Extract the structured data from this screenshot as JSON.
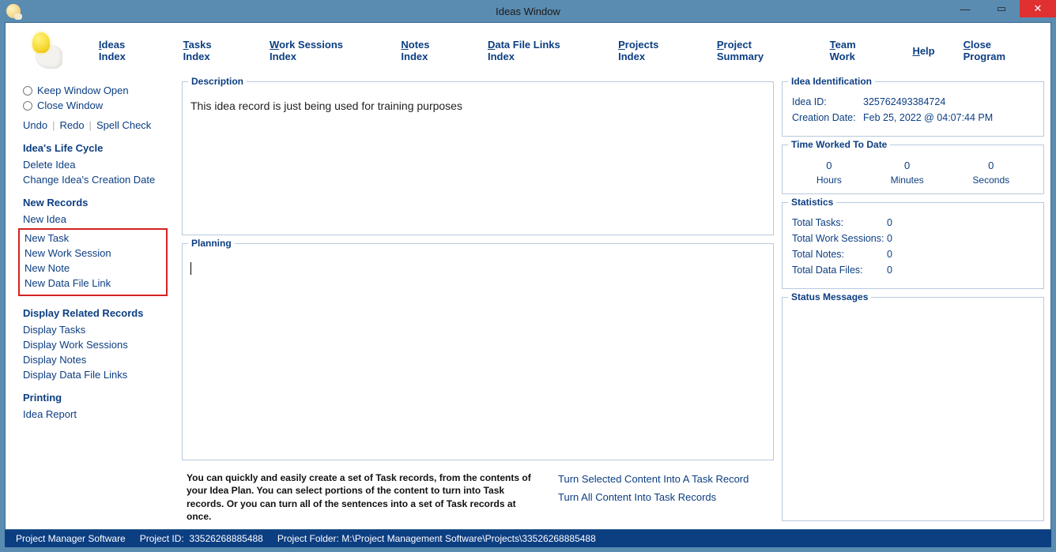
{
  "window": {
    "title": "Ideas Window"
  },
  "menubar": {
    "ideas_index": "deas Index",
    "tasks_index": "asks Index",
    "work_sessions_index": "ork Sessions Index",
    "notes_index": "otes Index",
    "data_file_links_index": "ata File Links Index",
    "projects_index": "rojects Index",
    "project_summary": "roject Summary",
    "team_work": "eam Work",
    "help": "elp",
    "close_program": "lose Program"
  },
  "sidebar": {
    "keep_window_open": "eep Window Open",
    "close_window": "lose Window",
    "undo": "Undo",
    "redo": "Redo",
    "spell_check": "Spell Check",
    "life_cycle_head": "Idea's Life Cycle",
    "delete_idea": "Delete Idea",
    "change_creation_date": "Change Idea's Creation Date",
    "new_records_head": "New Records",
    "new_idea": "New Idea",
    "new_task": "New Task",
    "new_work_session": "New Work Session",
    "new_note": "New Note",
    "new_data_file_link": "New Data File Link",
    "display_related_head": "Display Related Records",
    "display_tasks": "Display Tasks",
    "display_work_sessions": "Display Work Sessions",
    "display_notes": "Display Notes",
    "display_data_file_links": "Display Data File Links",
    "printing_head": "Printing",
    "idea_report": "Idea Report"
  },
  "description": {
    "legend": "Description",
    "text": "This idea record is just being used for training purposes"
  },
  "planning": {
    "legend": "Planning",
    "hint": "You can quickly and easily create a set of Task records, from the contents of your Idea Plan. You can select portions of the content to turn into Task records. Or you can turn all of the sentences into a set of Task records at once.",
    "turn_selected": "Turn Selected Content Into A Task Record",
    "turn_all": "Turn All Content Into Task Records"
  },
  "ident": {
    "legend": "Idea Identification",
    "id_label": "Idea ID:",
    "id_value": "325762493384724",
    "created_label": "Creation Date:",
    "created_value": "Feb  25, 2022 @ 04:07:44 PM"
  },
  "time": {
    "legend": "Time Worked To Date",
    "hours_v": "0",
    "hours_l": "Hours",
    "minutes_v": "0",
    "minutes_l": "Minutes",
    "seconds_v": "0",
    "seconds_l": "Seconds"
  },
  "stats": {
    "legend": "Statistics",
    "total_tasks_l": "Total Tasks:",
    "total_tasks_v": "0",
    "total_ws_l": "Total Work Sessions:",
    "total_ws_v": "0",
    "total_notes_l": "Total Notes:",
    "total_notes_v": "0",
    "total_df_l": "Total Data Files:",
    "total_df_v": "0"
  },
  "status_msgs": {
    "legend": "Status Messages"
  },
  "statusbar": {
    "app": "Project Manager Software",
    "project_id_l": "Project ID:",
    "project_id_v": "33526268885488",
    "project_folder_l": "Project Folder:",
    "project_folder_v": "M:\\Project Management Software\\Projects\\33526268885488"
  }
}
